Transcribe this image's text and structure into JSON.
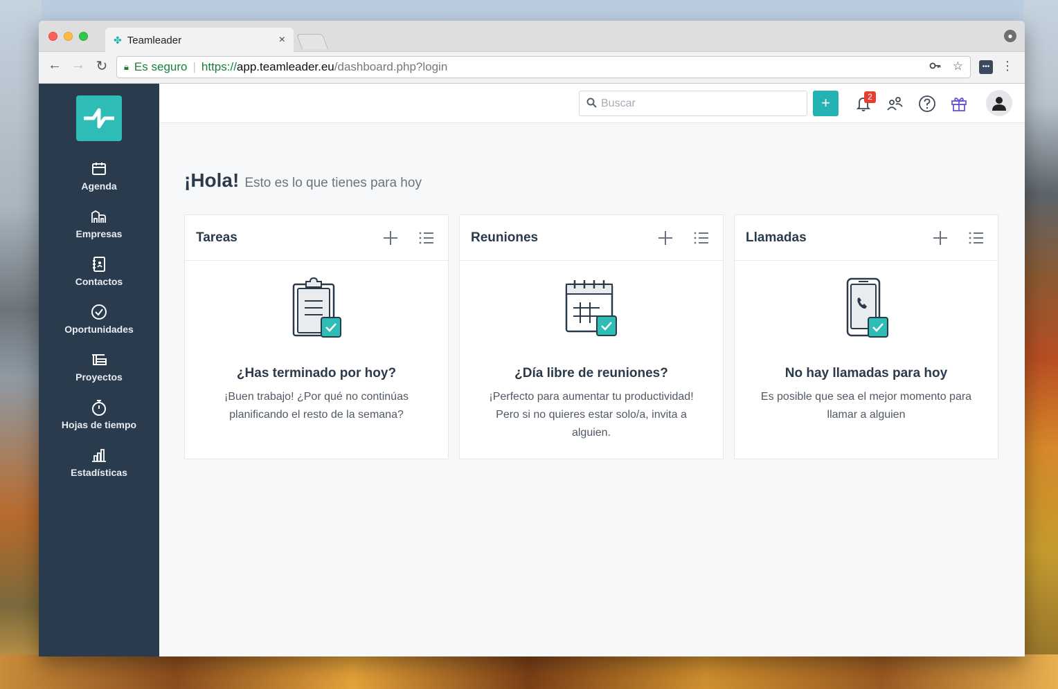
{
  "browser": {
    "tab_title": "Teamleader",
    "tab_close": "×",
    "secure_label": "Es seguro",
    "url_proto": "https://",
    "url_host": "app.teamleader.eu",
    "url_path": "/dashboard.php?login"
  },
  "sidebar": {
    "items": [
      {
        "label": "Agenda",
        "icon": "calendar-icon"
      },
      {
        "label": "Empresas",
        "icon": "buildings-icon"
      },
      {
        "label": "Contactos",
        "icon": "contact-book-icon"
      },
      {
        "label": "Oportunidades",
        "icon": "check-circle-icon"
      },
      {
        "label": "Proyectos",
        "icon": "projects-icon"
      },
      {
        "label": "Hojas de tiempo",
        "icon": "stopwatch-icon"
      },
      {
        "label": "Estadísticas",
        "icon": "bar-chart-icon"
      }
    ]
  },
  "topbar": {
    "search_placeholder": "Buscar",
    "add_label": "+",
    "notification_count": "2"
  },
  "greeting": {
    "title": "¡Hola!",
    "subtitle": "Esto es lo que tienes para hoy"
  },
  "cards": [
    {
      "title": "Tareas",
      "question": "¿Has terminado por hoy?",
      "text": "¡Buen trabajo! ¿Por qué no continúas planificando el resto de la semana?"
    },
    {
      "title": "Reuniones",
      "question": "¿Día libre de reuniones?",
      "text": "¡Perfecto para aumentar tu productividad! Pero si no quieres estar solo/a, invita a alguien."
    },
    {
      "title": "Llamadas",
      "question": "No hay llamadas para hoy",
      "text": "Es posible que sea el mejor momento para llamar a alguien"
    }
  ],
  "colors": {
    "brand": "#24b2b2",
    "sidebar": "#2a3b4d",
    "badge": "#e5402f"
  }
}
